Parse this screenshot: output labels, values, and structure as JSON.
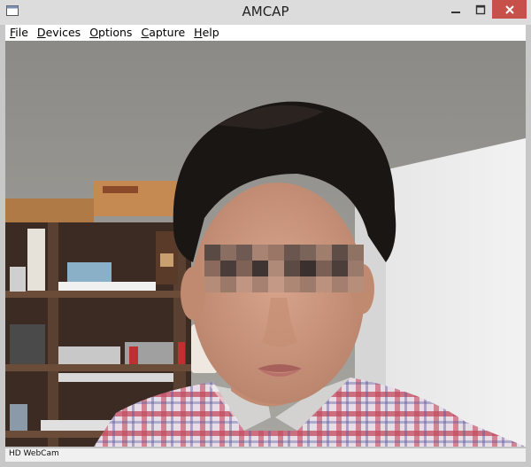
{
  "window": {
    "title": "AMCAP",
    "controls": {
      "minimize_icon": "minimize-icon",
      "maximize_icon": "maximize-icon",
      "close_icon": "close-icon"
    },
    "accent_close": "#c7504a"
  },
  "menubar": {
    "items": [
      {
        "accel": "F",
        "rest": "ile"
      },
      {
        "accel": "D",
        "rest": "evices"
      },
      {
        "accel": "O",
        "rest": "ptions"
      },
      {
        "accel": "C",
        "rest": "apture"
      },
      {
        "accel": "H",
        "rest": "elp"
      }
    ]
  },
  "status": {
    "device": "HD WebCam"
  },
  "video": {
    "description_icon": "webcam-preview",
    "censor": "pixelated-eyes"
  }
}
